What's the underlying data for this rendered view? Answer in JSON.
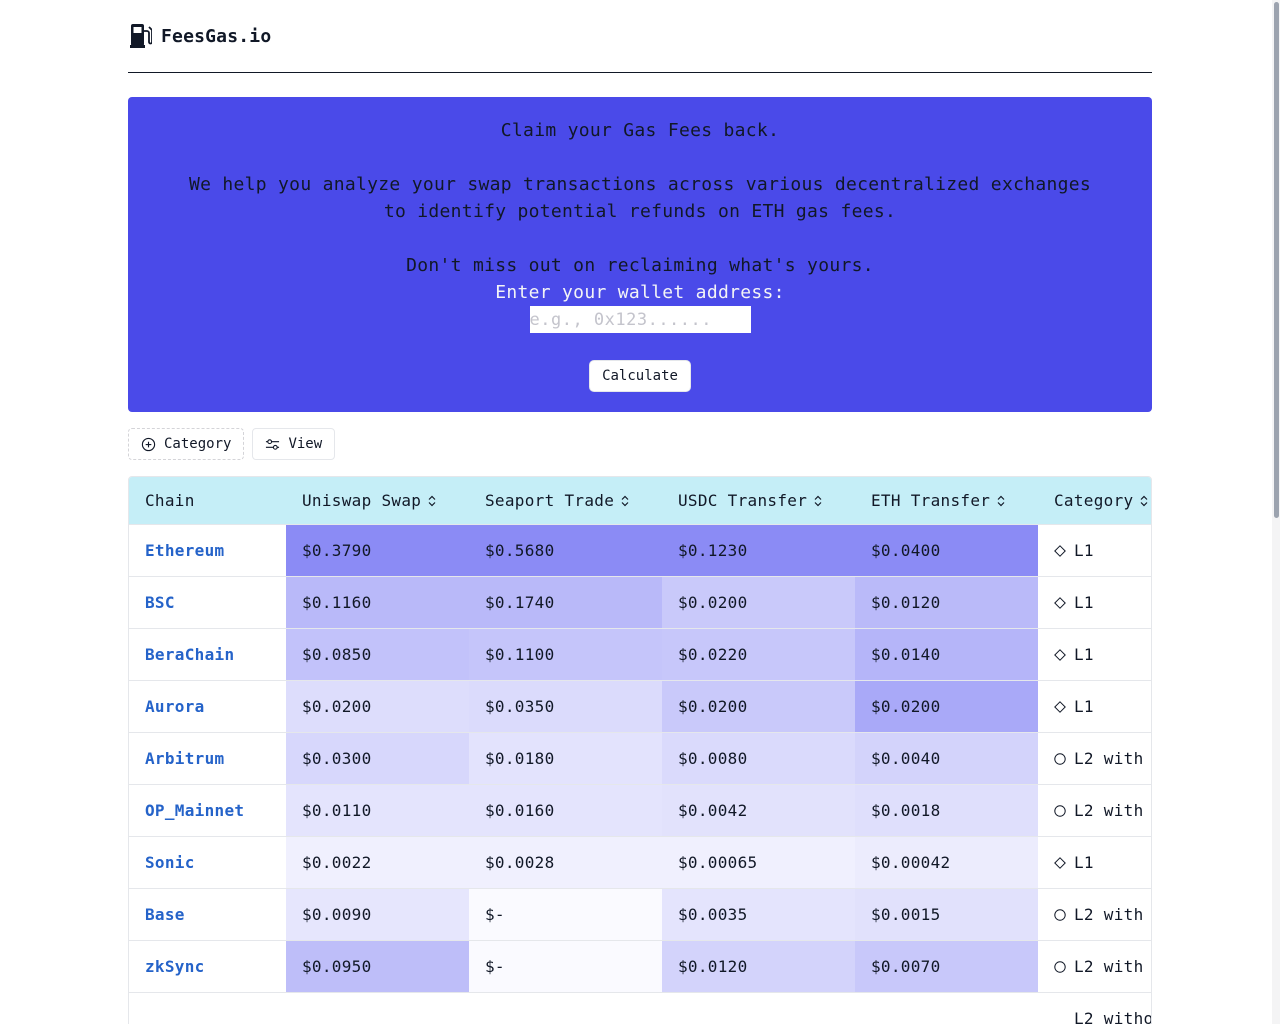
{
  "header": {
    "brand": "FeesGas.io",
    "logo_icon": "gas-pump-icon"
  },
  "hero": {
    "headline": "Claim your Gas Fees back.",
    "description": "We help you analyze your swap transactions across various decentralized exchanges to identify potential refunds on ETH gas fees.",
    "cta": "Don't miss out on reclaiming what's yours.",
    "input_label": "Enter your wallet address:",
    "input_placeholder": "e.g., 0x123......",
    "input_value": "",
    "button_label": "Calculate",
    "background": "#4a4ae9"
  },
  "toolbar": {
    "category_label": "Category",
    "category_icon": "plus-circle-icon",
    "view_label": "View",
    "view_icon": "sliders-icon"
  },
  "table": {
    "columns": [
      "Chain",
      "Uniswap Swap",
      "Seaport Trade",
      "USDC Transfer",
      "ETH Transfer",
      "Category"
    ],
    "rows": [
      {
        "chain": "Ethereum",
        "uniswap": "$0.3790",
        "seaport": "$0.5680",
        "usdc": "$0.1230",
        "eth": "$0.0400",
        "category": "L1",
        "category_icon": "diamond-icon"
      },
      {
        "chain": "BSC",
        "uniswap": "$0.1160",
        "seaport": "$0.1740",
        "usdc": "$0.0200",
        "eth": "$0.0120",
        "category": "L1",
        "category_icon": "diamond-icon"
      },
      {
        "chain": "BeraChain",
        "uniswap": "$0.0850",
        "seaport": "$0.1100",
        "usdc": "$0.0220",
        "eth": "$0.0140",
        "category": "L1",
        "category_icon": "diamond-icon"
      },
      {
        "chain": "Aurora",
        "uniswap": "$0.0200",
        "seaport": "$0.0350",
        "usdc": "$0.0200",
        "eth": "$0.0200",
        "category": "L1",
        "category_icon": "diamond-icon"
      },
      {
        "chain": "Arbitrum",
        "uniswap": "$0.0300",
        "seaport": "$0.0180",
        "usdc": "$0.0080",
        "eth": "$0.0040",
        "category": "L2 with",
        "category_icon": "circle-icon"
      },
      {
        "chain": "OP_Mainnet",
        "uniswap": "$0.0110",
        "seaport": "$0.0160",
        "usdc": "$0.0042",
        "eth": "$0.0018",
        "category": "L2 with",
        "category_icon": "circle-icon"
      },
      {
        "chain": "Sonic",
        "uniswap": "$0.0022",
        "seaport": "$0.0028",
        "usdc": "$0.00065",
        "eth": "$0.00042",
        "category": "L1",
        "category_icon": "diamond-icon"
      },
      {
        "chain": "Base",
        "uniswap": "$0.0090",
        "seaport": "$-",
        "usdc": "$0.0035",
        "eth": "$0.0015",
        "category": "L2 with",
        "category_icon": "circle-icon"
      },
      {
        "chain": "zkSync",
        "uniswap": "$0.0950",
        "seaport": "$-",
        "usdc": "$0.0120",
        "eth": "$0.0070",
        "category": "L2 with",
        "category_icon": "circle-icon"
      }
    ],
    "partial_row": {
      "category": "L2 witho"
    },
    "header_background": "#c5eef7",
    "heat_color": "#8b8bf5"
  }
}
